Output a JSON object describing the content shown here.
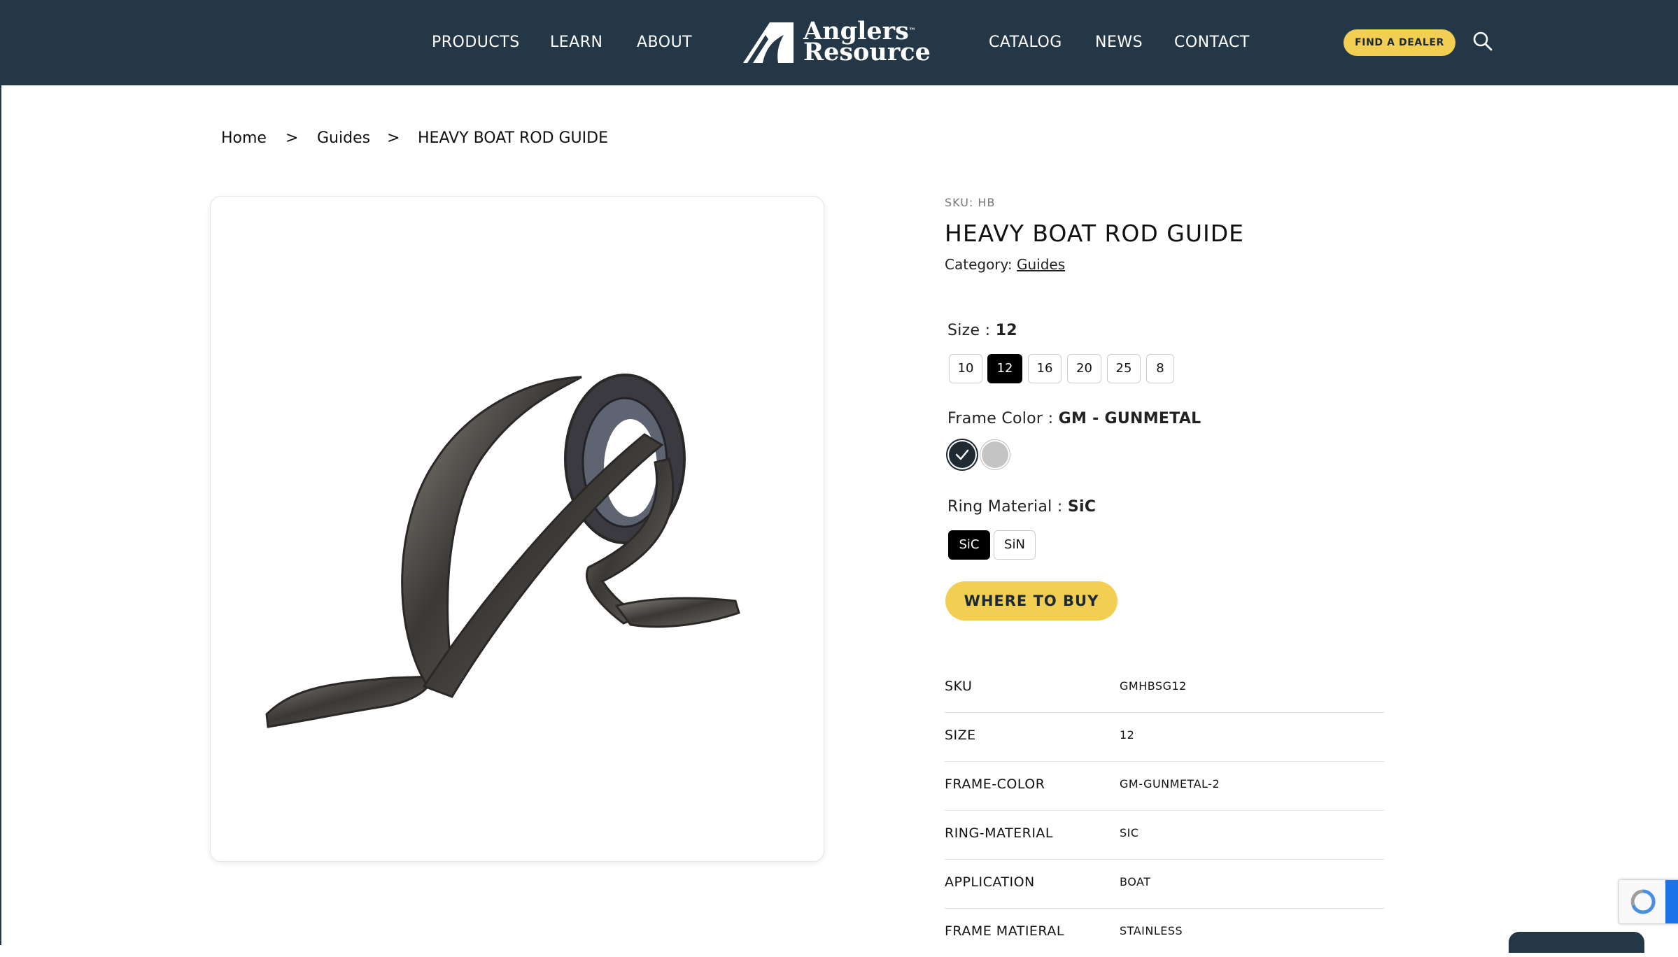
{
  "brand": {
    "line1": "Anglers",
    "tm": "™",
    "line2": "Resource"
  },
  "nav": {
    "left": [
      "PRODUCTS",
      "LEARN",
      "ABOUT"
    ],
    "right": [
      "CATALOG",
      "NEWS",
      "CONTACT"
    ],
    "dealer_button": "FIND A DEALER",
    "search_icon": "search-icon"
  },
  "breadcrumb": {
    "items": [
      "Home",
      "Guides",
      "HEAVY BOAT ROD GUIDE"
    ],
    "separator": ">"
  },
  "product": {
    "sku_line": "SKU: HB",
    "title": "HEAVY BOAT ROD GUIDE",
    "category_label": "Category:",
    "category_value": "Guides",
    "image_alt": "heavy boat rod guide image"
  },
  "options": {
    "size": {
      "label": "Size",
      "selected": "12",
      "values": [
        "10",
        "12",
        "16",
        "20",
        "25",
        "8"
      ]
    },
    "frame_color": {
      "label": "Frame Color",
      "selected": "GM - GUNMETAL",
      "swatches": [
        {
          "name": "gunmetal",
          "color": "#1f2a33",
          "selected": true
        },
        {
          "name": "silver",
          "color": "#c4c4c4",
          "selected": false
        }
      ]
    },
    "ring_material": {
      "label": "Ring Material",
      "selected": "SiC",
      "values": [
        "SiC",
        "SiN"
      ]
    }
  },
  "where_to_buy": "WHERE TO BUY",
  "specs": [
    {
      "key": "SKU",
      "value": "GMHBSG12"
    },
    {
      "key": "SIZE",
      "value": "12"
    },
    {
      "key": "FRAME-COLOR",
      "value": "GM-GUNMETAL-2"
    },
    {
      "key": "RING-MATERIAL",
      "value": "SIC"
    },
    {
      "key": "APPLICATION",
      "value": "BOAT"
    },
    {
      "key": "FRAME MATIERAL",
      "value": "STAINLESS"
    }
  ],
  "colors": {
    "header_bg": "#243746",
    "accent_yellow": "#f2cf53",
    "selected_black": "#000000"
  }
}
